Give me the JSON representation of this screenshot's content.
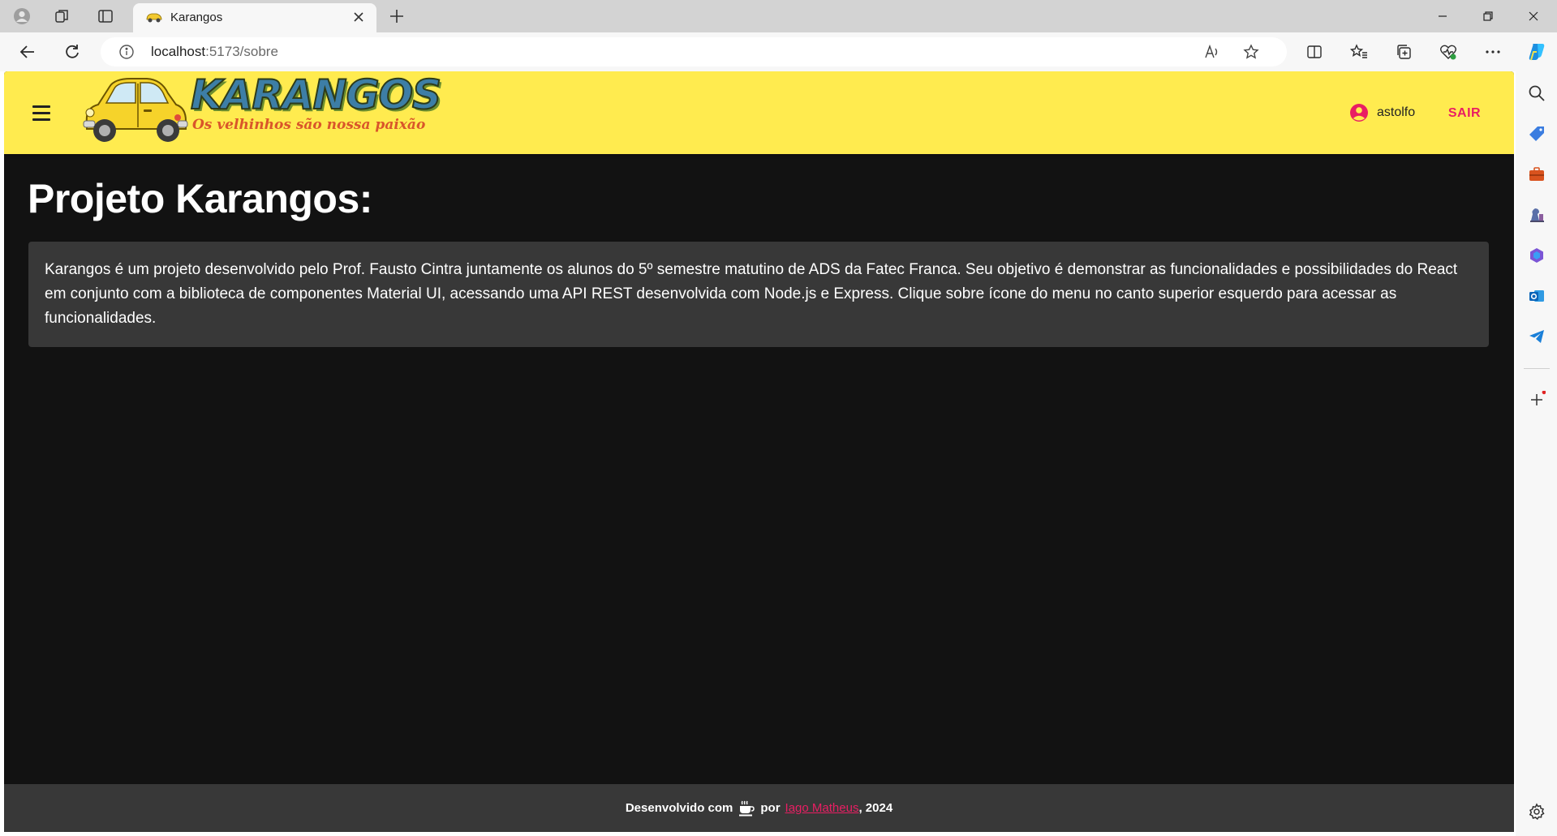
{
  "browser": {
    "tab_title": "Karangos",
    "url_host": "localhost",
    "url_path": ":5173/sobre"
  },
  "header": {
    "logo_title": "KARANGOS",
    "logo_slogan": "Os velhinhos são nossa paixão",
    "username": "astolfo",
    "logout_label": "SAIR"
  },
  "main": {
    "title": "Projeto Karangos:",
    "description": "Karangos é um projeto desenvolvido pelo Prof. Fausto Cintra juntamente os alunos do 5º semestre matutino de ADS da Fatec Franca. Seu objetivo é demonstrar as funcionalidades e possibilidades do React em conjunto com a biblioteca de componentes Material UI, acessando uma API REST desenvolvida com Node.js e Express. Clique sobre ícone do menu no canto superior esquerdo para acessar as funcionalidades."
  },
  "footer": {
    "prefix": "Desenvolvido com",
    "middle": "por",
    "author": "Iago Matheus",
    "year": ", 2024"
  },
  "colors": {
    "appbar": "#ffeb4f",
    "accent": "#e91e63",
    "background": "#121212",
    "paper": "#383838"
  }
}
